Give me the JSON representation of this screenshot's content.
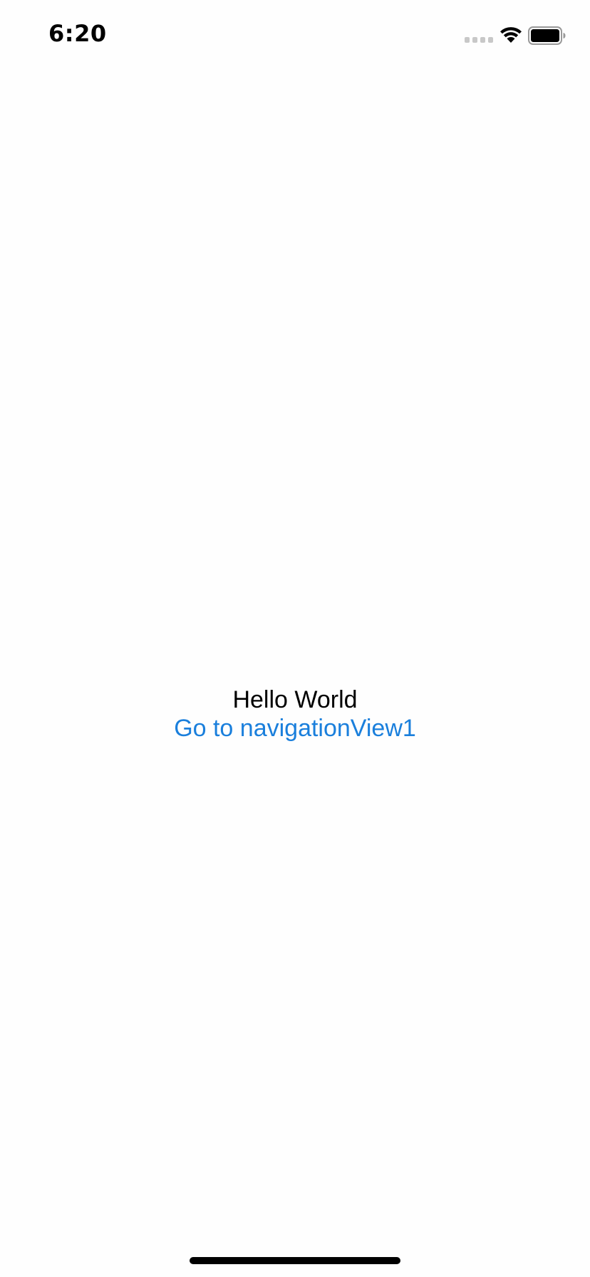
{
  "status_bar": {
    "time": "6:20",
    "signal_icon": "cellular-signal-icon",
    "wifi_icon": "wifi-icon",
    "battery_icon": "battery-icon",
    "battery_level": 1.0
  },
  "main": {
    "title": "Hello World",
    "link_label": "Go to navigationView1",
    "link_color": "#1a7fdc"
  }
}
